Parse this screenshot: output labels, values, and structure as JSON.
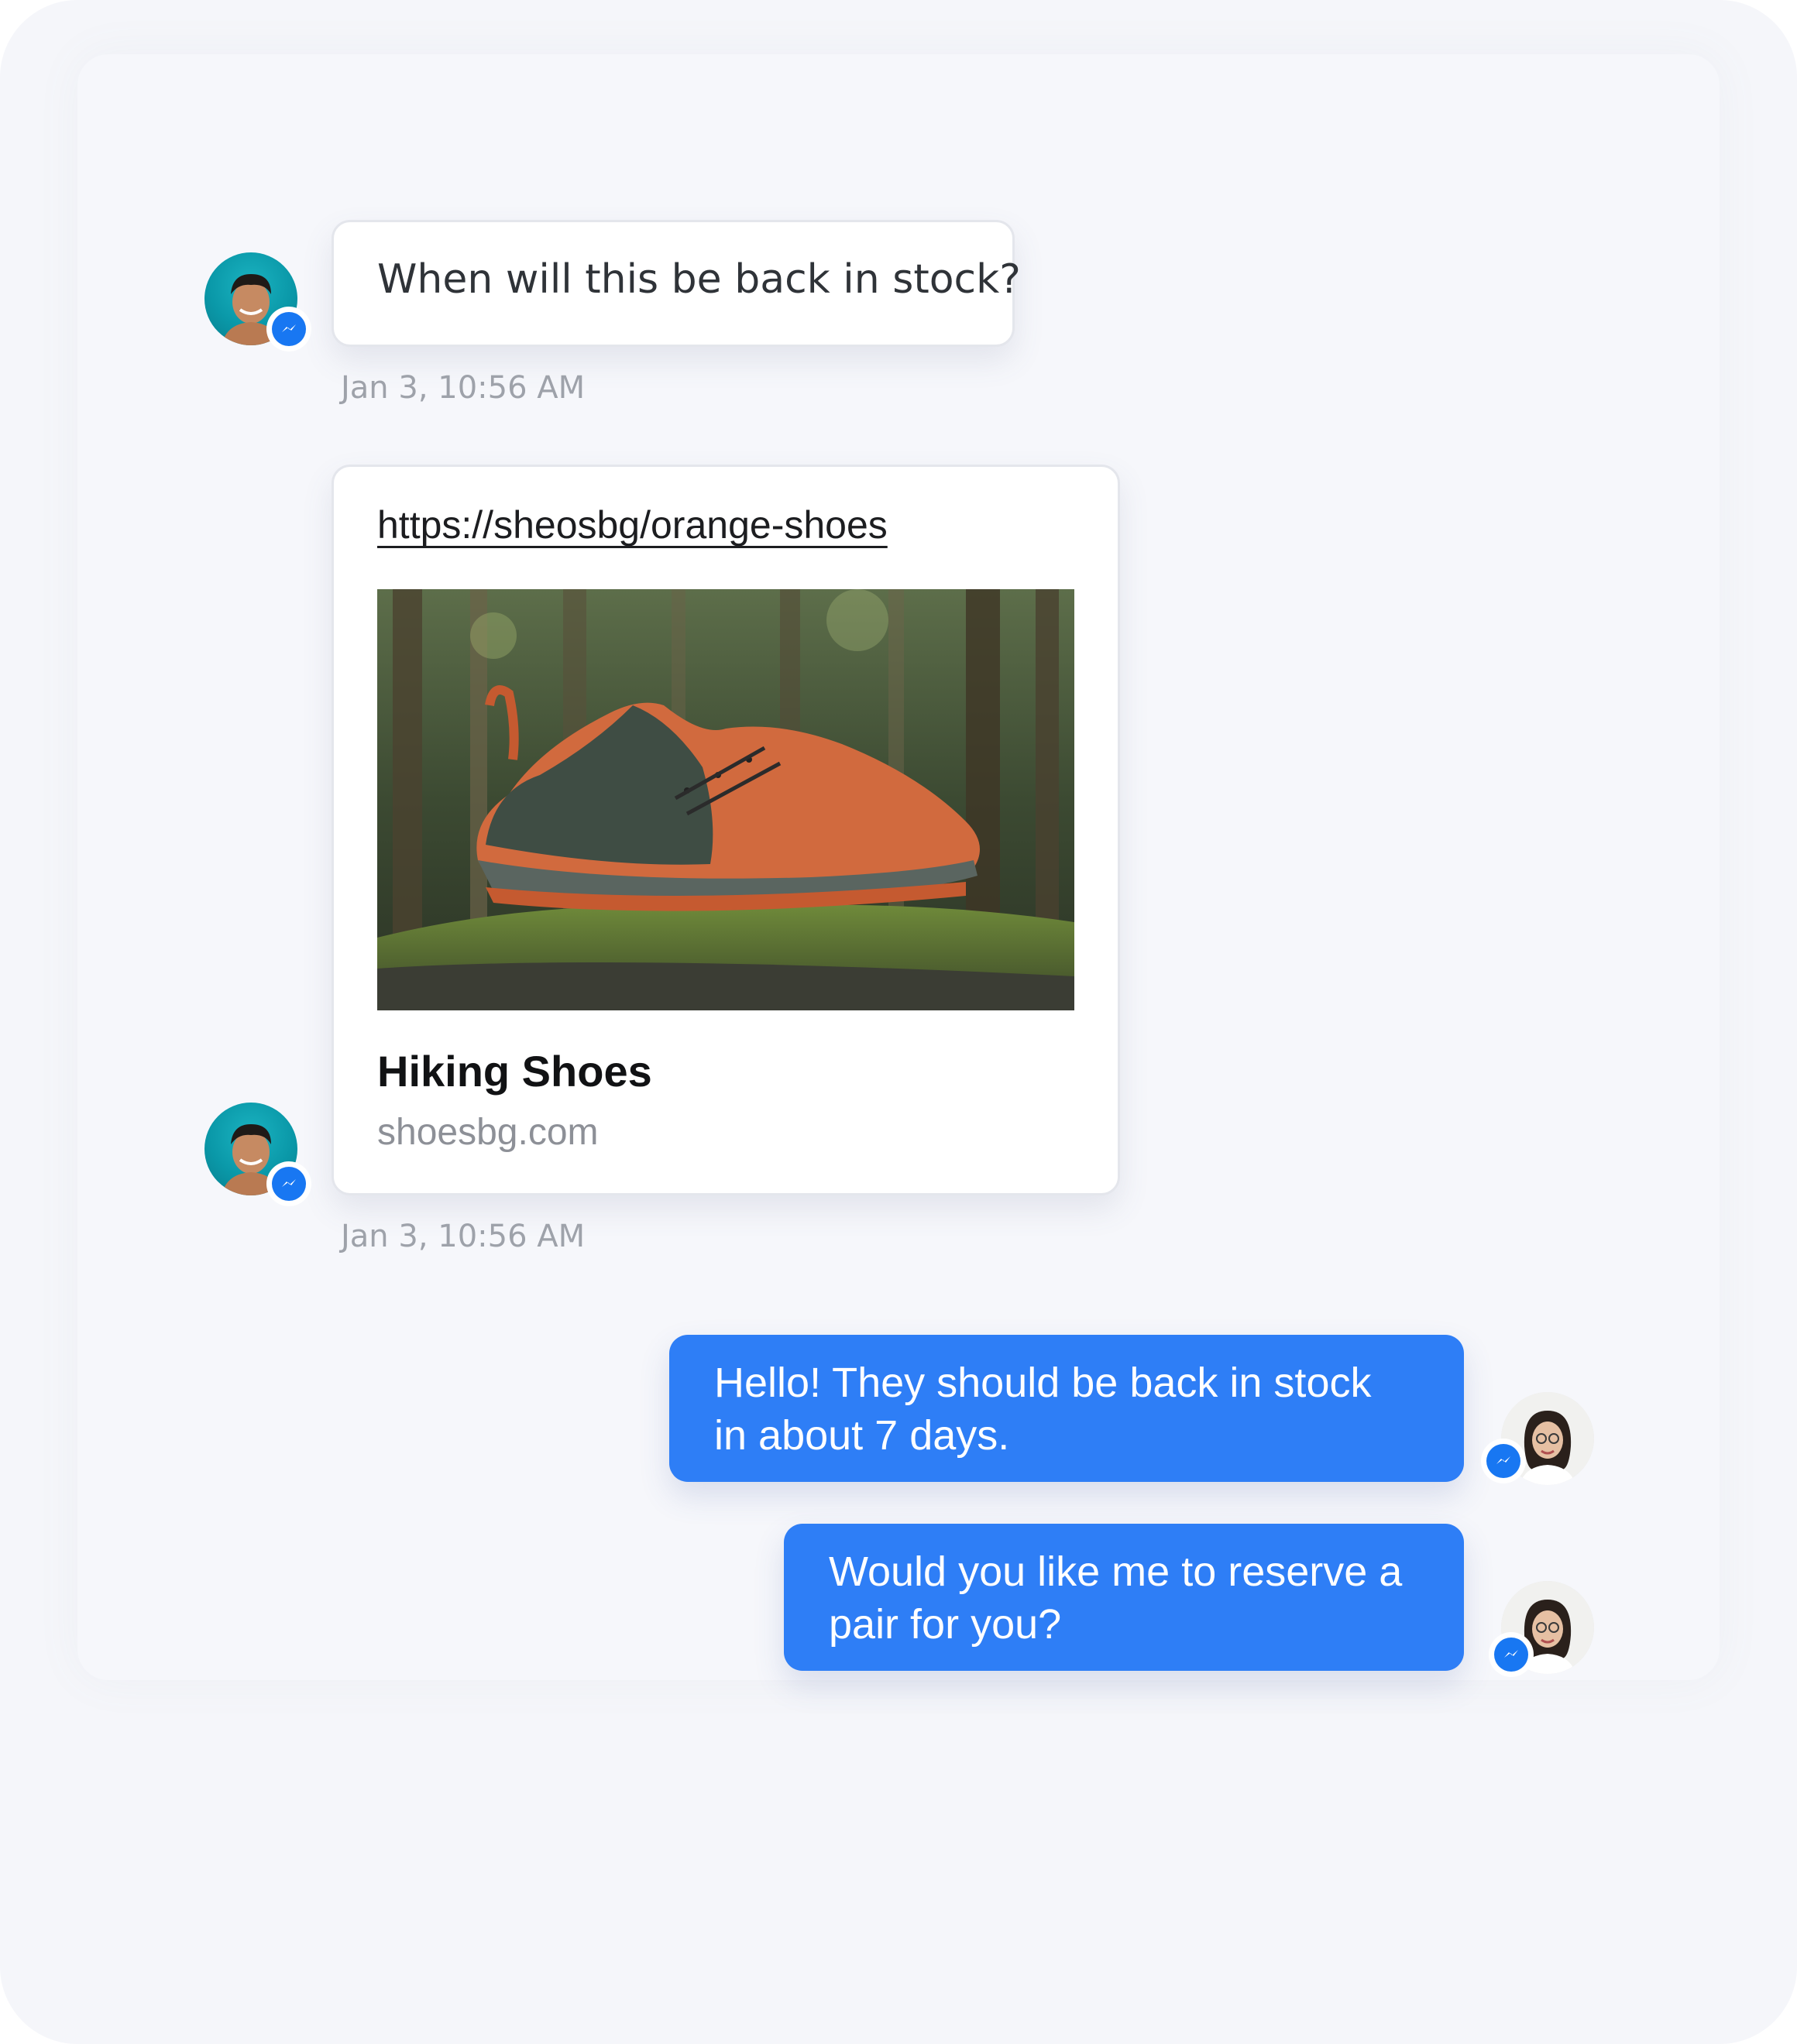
{
  "conversation": {
    "messages": [
      {
        "sender": "customer",
        "text": "When will this be back in stock?",
        "timestamp": "Jan 3, 10:56 AM"
      },
      {
        "sender": "customer",
        "type": "link_preview",
        "url": "https://sheosbg/orange-shoes",
        "title": "Hiking Shoes",
        "domain": "shoesbg.com",
        "timestamp": "Jan 3, 10:56 AM"
      },
      {
        "sender": "agent",
        "text_line1": "Hello! They should be back in stock",
        "text_line2": "in about 7 days."
      },
      {
        "sender": "agent",
        "text_line1": "Would you like me to reserve a",
        "text_line2": "pair for you?"
      }
    ],
    "channel_icon": "messenger-icon"
  },
  "colors": {
    "outgoing_bubble": "#2e7ef6",
    "messenger_blue": "#1877f2",
    "background": "#f5f6fa"
  }
}
